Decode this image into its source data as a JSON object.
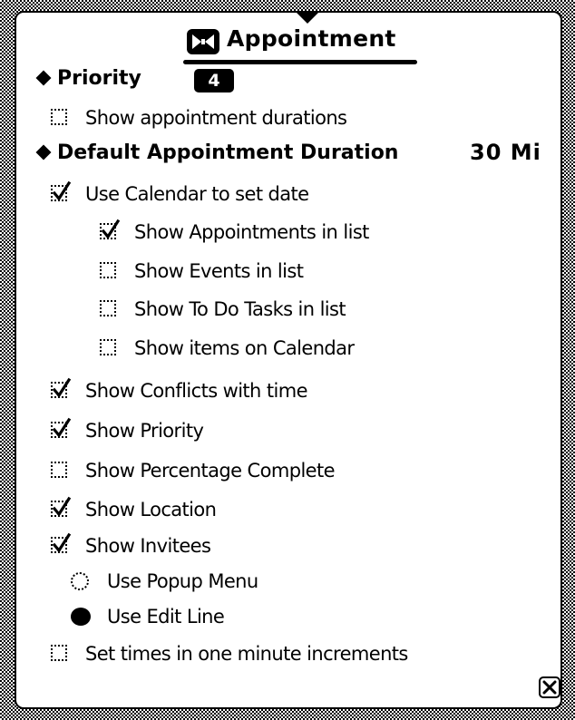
{
  "title": "Appointment",
  "priority": {
    "label": "Priority",
    "value": "4"
  },
  "duration": {
    "label": "Default Appointment Duration",
    "value": "30 Mi"
  },
  "items": [
    {
      "id": "show-appointment-durations",
      "label": "Show appointment durations",
      "checked": false
    },
    {
      "id": "use-calendar",
      "label": "Use Calendar to set date",
      "checked": true
    },
    {
      "id": "show-appointments-in-list",
      "label": "Show Appointments in list",
      "checked": true
    },
    {
      "id": "show-events-in-list",
      "label": "Show Events in list",
      "checked": false
    },
    {
      "id": "show-todo-tasks-in-list",
      "label": "Show To Do Tasks in list",
      "checked": false
    },
    {
      "id": "show-items-on-calendar",
      "label": "Show items on Calendar",
      "checked": false
    },
    {
      "id": "show-conflicts",
      "label": "Show Conflicts with time",
      "checked": true
    },
    {
      "id": "show-priority",
      "label": "Show Priority",
      "checked": true
    },
    {
      "id": "show-percentage-complete",
      "label": "Show Percentage Complete",
      "checked": false
    },
    {
      "id": "show-location",
      "label": "Show Location",
      "checked": true
    },
    {
      "id": "show-invitees",
      "label": "Show Invitees",
      "checked": true
    },
    {
      "id": "set-times-one-minute",
      "label": "Set times in one minute increments",
      "checked": false
    }
  ],
  "radios": [
    {
      "id": "use-popup-menu",
      "label": "Use Popup Menu",
      "selected": false
    },
    {
      "id": "use-edit-line",
      "label": "Use Edit Line",
      "selected": true
    }
  ],
  "icons": {
    "title": "appointment-bowtie-icon",
    "close": "close-box-icon",
    "checkbox_check": "check-mark-icon"
  }
}
